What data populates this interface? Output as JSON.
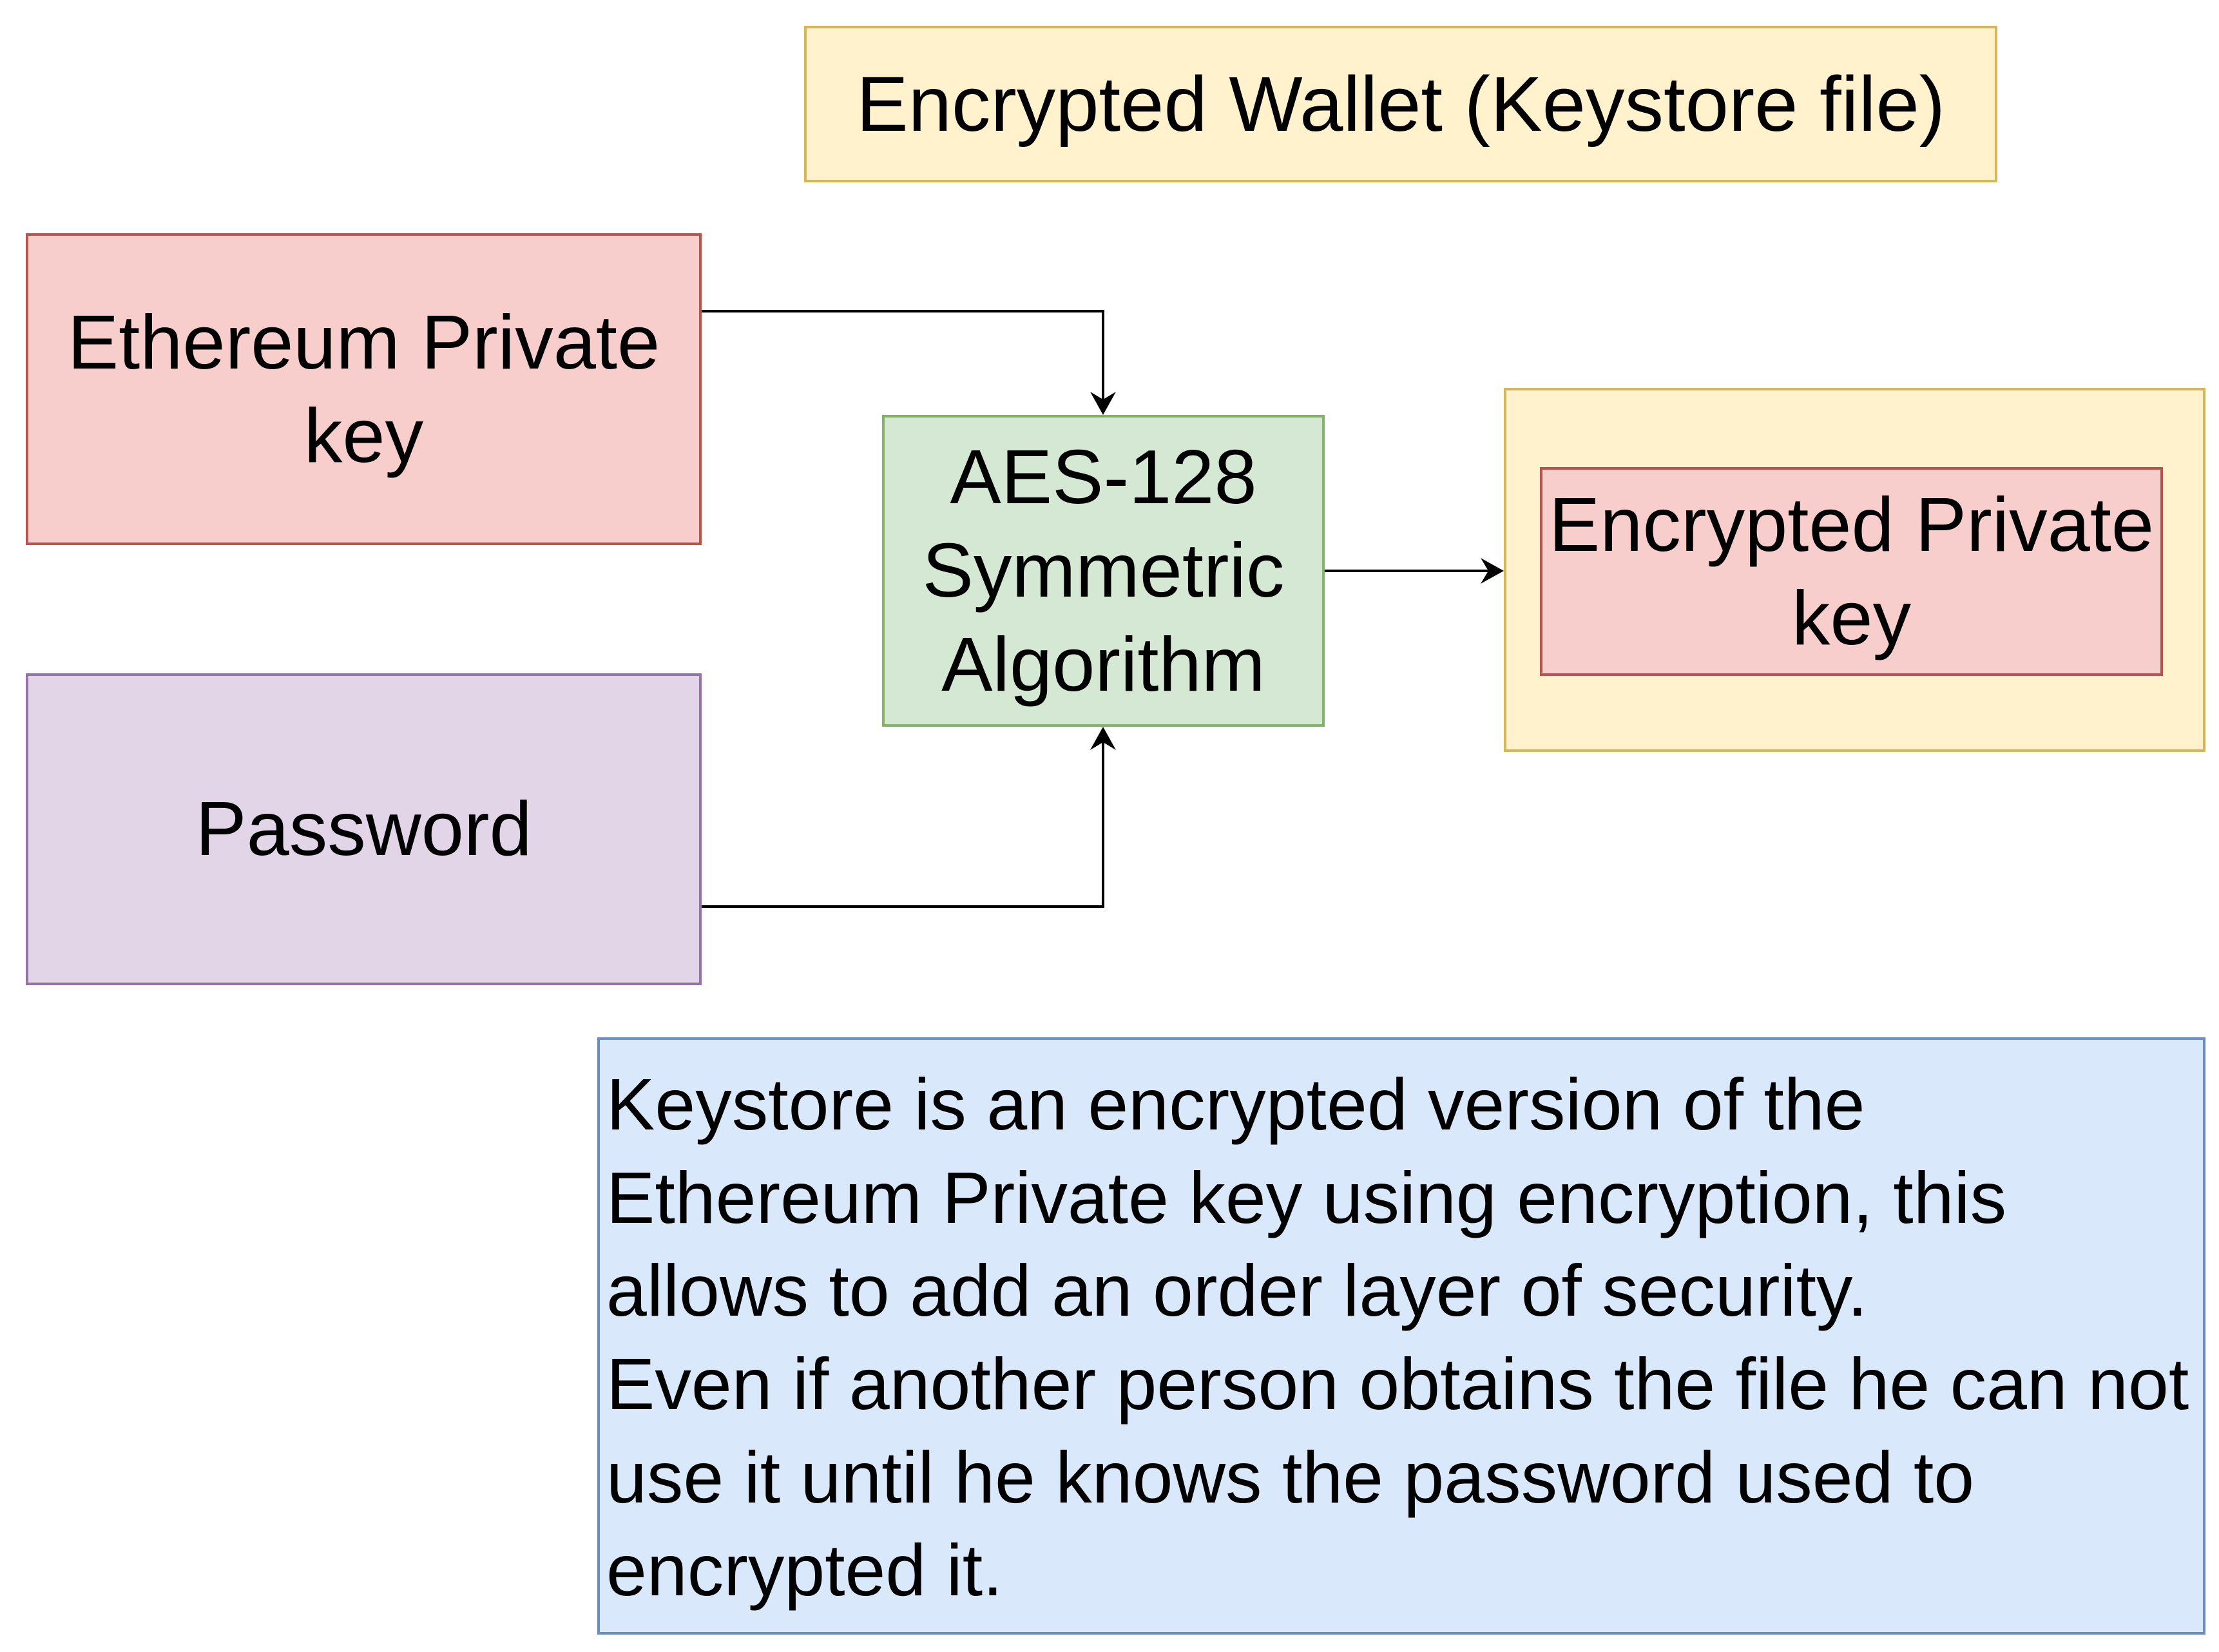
{
  "nodes": {
    "wallet_title": "Encrypted Wallet (Keystore file)",
    "private_key": [
      "Ethereum Private",
      "key"
    ],
    "password": "Password",
    "aes": [
      "AES-128",
      "Symmetric",
      "Algorithm"
    ],
    "encrypted_key": [
      "Encrypted Private",
      "key"
    ]
  },
  "explanation": {
    "paragraph1": "Keystore is an encrypted version of the Ethereum Private key using encryption, this allows to add an order layer of security.",
    "paragraph2": "Even if another person obtains the file he can not use it until he knows the password used to encrypted it."
  },
  "edges": [
    {
      "from": "private-key-box",
      "to": "aes-box"
    },
    {
      "from": "password-box",
      "to": "aes-box"
    },
    {
      "from": "aes-box",
      "to": "keystore-container"
    }
  ],
  "colors": {
    "wallet_fill": "#fff2cc",
    "wallet_stroke": "#d6b656",
    "red_fill": "#f8cecc",
    "red_stroke": "#b85450",
    "purple_fill": "#e1d5e7",
    "purple_stroke": "#9673a6",
    "green_fill": "#d5e8d4",
    "green_stroke": "#82b366",
    "blue_fill": "#dae8fc",
    "blue_stroke": "#6c8ebf",
    "edge": "#000000"
  }
}
